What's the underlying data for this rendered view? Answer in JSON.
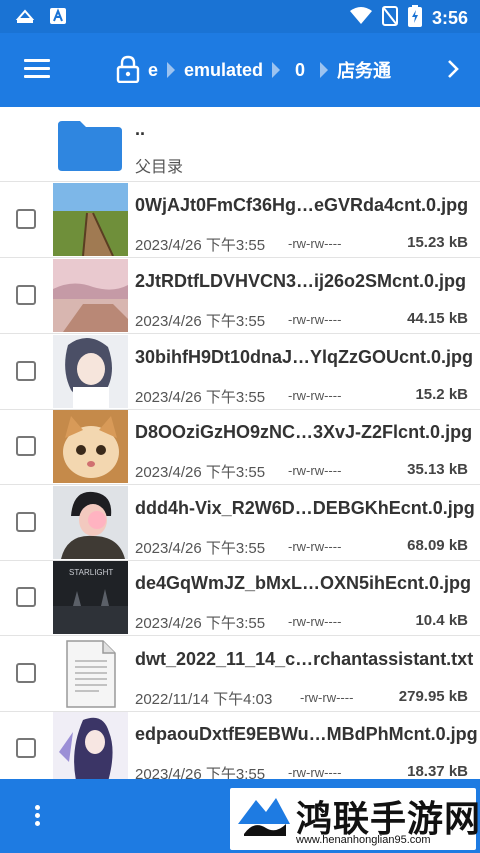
{
  "status_bar": {
    "time": "3:56",
    "icons": [
      "sync-icon",
      "a-notification-icon",
      "wifi-icon",
      "no-sim-icon",
      "battery-charging-icon"
    ]
  },
  "toolbar": {
    "menu_icon": "hamburger-menu-icon",
    "lock_icon": "lock-icon",
    "breadcrumbs": [
      "e",
      "emulated",
      "0",
      "店务通"
    ],
    "next_icon": "chevron-right-icon"
  },
  "parent": {
    "dots": "..",
    "label": "父目录",
    "icon": "folder-icon"
  },
  "files": [
    {
      "name": "0WjAJt0FmCf36Hg…eGVRda4cnt.0.jpg",
      "date": "2023/4/26 下午3:55",
      "perm": "-rw-rw----",
      "size": "15.23 kB",
      "thumb": "image"
    },
    {
      "name": "2JtRDtfLDVHVCN3…ij26o2SMcnt.0.jpg",
      "date": "2023/4/26 下午3:55",
      "perm": "-rw-rw----",
      "size": "44.15 kB",
      "thumb": "image"
    },
    {
      "name": "30bihfH9Dt10dnaJ…YlqZzGOUcnt.0.jpg",
      "date": "2023/4/26 下午3:55",
      "perm": "-rw-rw----",
      "size": "15.2 kB",
      "thumb": "image"
    },
    {
      "name": "D8OOziGzHO9zNC…3XvJ-Z2Flcnt.0.jpg",
      "date": "2023/4/26 下午3:55",
      "perm": "-rw-rw----",
      "size": "35.13 kB",
      "thumb": "image"
    },
    {
      "name": "ddd4h-Vix_R2W6D…DEBGKhEcnt.0.jpg",
      "date": "2023/4/26 下午3:55",
      "perm": "-rw-rw----",
      "size": "68.09 kB",
      "thumb": "image"
    },
    {
      "name": "de4GqWmJZ_bMxL…OXN5ihEcnt.0.jpg",
      "date": "2023/4/26 下午3:55",
      "perm": "-rw-rw----",
      "size": "10.4 kB",
      "thumb": "image",
      "thumb_text": "STARLIGHT"
    },
    {
      "name": "dwt_2022_11_14_c…rchantassistant.txt",
      "date": "2022/11/14 下午4:03",
      "perm": "-rw-rw----",
      "size": "279.95 kB",
      "thumb": "text-document"
    },
    {
      "name": "edpaouDxtfE9EBWu…MBdPhMcnt.0.jpg",
      "date": "2023/4/26 下午3:55",
      "perm": "-rw-rw----",
      "size": "18.37 kB",
      "thumb": "image"
    }
  ],
  "bottom_bar": {
    "more_icon": "more-vertical-icon"
  },
  "watermark": {
    "title": "鸿联手游网",
    "url": "www.henanhonglian95.com"
  },
  "colors": {
    "primary": "#1e7be2",
    "status_bar": "#1a73d4",
    "folder": "#2f86e0"
  }
}
